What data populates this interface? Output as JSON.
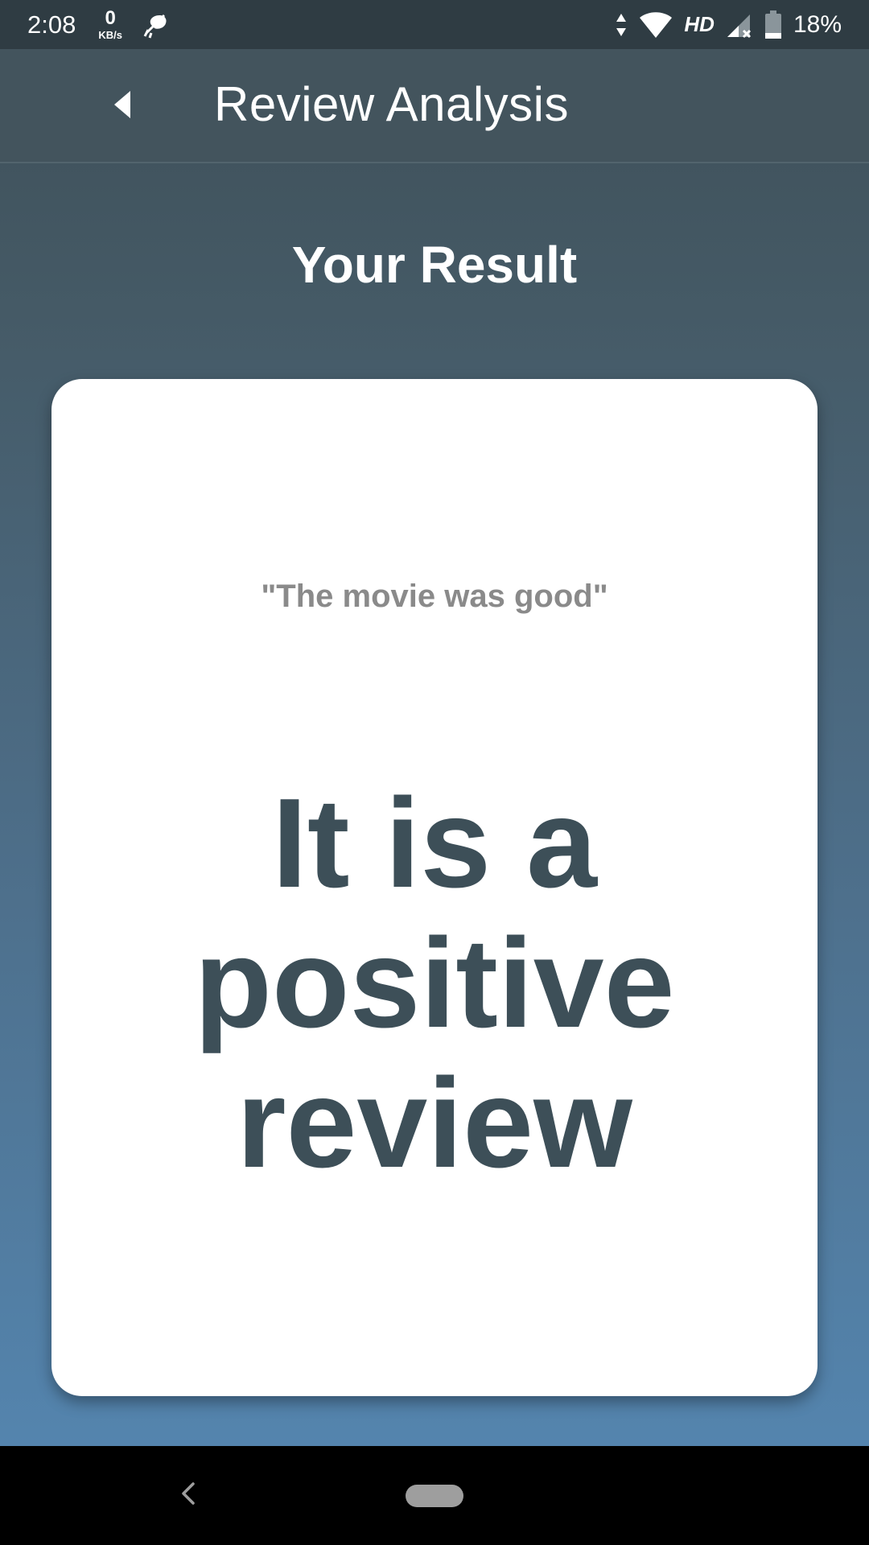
{
  "status_bar": {
    "time": "2:08",
    "net_speed_value": "0",
    "net_speed_unit": "KB/s",
    "hd_label": "HD",
    "battery_percent": "18%",
    "icons": [
      "mic-off-icon",
      "data-arrows-icon",
      "wifi-icon",
      "signal-icon",
      "battery-icon"
    ]
  },
  "app_bar": {
    "title": "Review Analysis",
    "back_icon": "back-arrow-icon"
  },
  "main": {
    "heading": "Your Result",
    "card": {
      "quote": "\"The movie was good\"",
      "verdict": "It is a positive review"
    }
  },
  "nav_bar": {
    "icons": [
      "nav-back-icon",
      "nav-home-pill"
    ]
  },
  "colors": {
    "app_bar": "#43545d",
    "status_bar": "#2f3c43",
    "gradient_top": "#3d4e57",
    "gradient_bottom": "#5588b4",
    "verdict_text": "#3d4f58",
    "quote_text": "#8a8a8a"
  }
}
